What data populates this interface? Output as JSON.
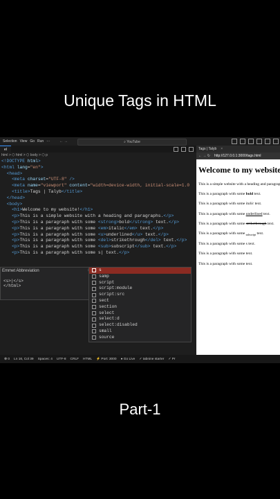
{
  "heading": "Unique Tags in HTML",
  "footer": "Part-1",
  "titlebar": {
    "menu": [
      "Selection",
      "View",
      "Go",
      "Run",
      "···"
    ],
    "nav": "←  →",
    "search": "⌕ YouTube"
  },
  "editor": {
    "tab": "el",
    "breadcrumb": "html > ⬡ html > ⬡ body > ⬡ p",
    "code_lines": [
      [
        [
          "tg",
          "<!DOCTYPE "
        ],
        [
          "at",
          "html"
        ],
        [
          "tg",
          ">"
        ]
      ],
      [
        [
          "tg",
          "<html "
        ],
        [
          "at",
          "lang"
        ],
        [
          "tx",
          "="
        ],
        [
          "st",
          "\"en\""
        ],
        [
          "tg",
          ">"
        ]
      ],
      [
        [
          "tx",
          "  "
        ],
        [
          "tg",
          "<head>"
        ]
      ],
      [
        [
          "tx",
          "    "
        ],
        [
          "tg",
          "<meta "
        ],
        [
          "at",
          "charset"
        ],
        [
          "tx",
          "="
        ],
        [
          "st",
          "\"UTF-8\""
        ],
        [
          "tx",
          " "
        ],
        [
          "tg",
          "/>"
        ]
      ],
      [
        [
          "tx",
          "    "
        ],
        [
          "tg",
          "<meta "
        ],
        [
          "at",
          "name"
        ],
        [
          "tx",
          "="
        ],
        [
          "st",
          "\"viewport\""
        ],
        [
          "tx",
          " "
        ],
        [
          "at",
          "content"
        ],
        [
          "tx",
          "="
        ],
        [
          "st",
          "\"width=device-width, initial-scale=1.0"
        ]
      ],
      [
        [
          "tx",
          "    "
        ],
        [
          "tg",
          "<title>"
        ],
        [
          "tx",
          "Tags | Talyb"
        ],
        [
          "tg",
          "</title>"
        ]
      ],
      [
        [
          "tx",
          "  "
        ],
        [
          "tg",
          "</head>"
        ]
      ],
      [
        [
          "tx",
          "  "
        ],
        [
          "tg",
          "<body>"
        ]
      ],
      [
        [
          "tx",
          "    "
        ],
        [
          "tg",
          "<h1>"
        ],
        [
          "tx",
          "Welcome to my website!"
        ],
        [
          "tg",
          "</h1>"
        ]
      ],
      [
        [
          "tx",
          "    "
        ],
        [
          "tg",
          "<p>"
        ],
        [
          "tx",
          "This is a simple website with a heading and paragraphs."
        ],
        [
          "tg",
          "</p>"
        ]
      ],
      [
        [
          "tx",
          "    "
        ],
        [
          "tg",
          "<p>"
        ],
        [
          "tx",
          "This is a paragraph with some "
        ],
        [
          "tg",
          "<strong>"
        ],
        [
          "tx",
          "bold"
        ],
        [
          "tg",
          "</strong>"
        ],
        [
          "tx",
          " text."
        ],
        [
          "tg",
          "</p>"
        ]
      ],
      [
        [
          "tx",
          "    "
        ],
        [
          "tg",
          "<p>"
        ],
        [
          "tx",
          "This is a paragraph with some "
        ],
        [
          "tg",
          "<em>"
        ],
        [
          "tx",
          "italic"
        ],
        [
          "tg",
          "</em>"
        ],
        [
          "tx",
          " text."
        ],
        [
          "tg",
          "</p>"
        ]
      ],
      [
        [
          "tx",
          "    "
        ],
        [
          "tg",
          "<p>"
        ],
        [
          "tx",
          "This is a paragraph with some "
        ],
        [
          "tg",
          "<u>"
        ],
        [
          "tx",
          "underlined"
        ],
        [
          "tg",
          "</u>"
        ],
        [
          "tx",
          " text."
        ],
        [
          "tg",
          "</p>"
        ]
      ],
      [
        [
          "tx",
          "    "
        ],
        [
          "tg",
          "<p>"
        ],
        [
          "tx",
          "This is a paragraph with some "
        ],
        [
          "tg",
          "<del>"
        ],
        [
          "tx",
          "strikethrough"
        ],
        [
          "tg",
          "</del>"
        ],
        [
          "tx",
          " text."
        ],
        [
          "tg",
          "</p>"
        ]
      ],
      [
        [
          "tx",
          "    "
        ],
        [
          "tg",
          "<p>"
        ],
        [
          "tx",
          "This is a paragraph with some "
        ],
        [
          "tg",
          "<sub>"
        ],
        [
          "tx",
          "subscript"
        ],
        [
          "tg",
          "</sub>"
        ],
        [
          "tx",
          " text."
        ],
        [
          "tg",
          "</p>"
        ]
      ],
      [
        [
          "tx",
          "    "
        ],
        [
          "tg",
          "<p>"
        ],
        [
          "tx",
          "This is a paragraph with some s| text."
        ],
        [
          "tg",
          "</p>"
        ]
      ]
    ],
    "emmet": {
      "title": "Emmet Abbreviation",
      "close": "×",
      "lines": [
        "<s>|</s>",
        "</html>"
      ]
    },
    "suggestions": [
      "s",
      "samp",
      "script",
      "script:module",
      "script:src",
      "sect",
      "section",
      "select",
      "select:d",
      "select:disabled",
      "small",
      "source"
    ]
  },
  "browser": {
    "tab": "Tags | Talyb",
    "tab_close": "×",
    "nav": "←  →  ↻",
    "url": "http://127.0.0.1:3000/tags.html",
    "page": {
      "h1": "Welcome to my website!",
      "p1": "This is a simple website with a heading and paragraphs.",
      "p_prefix": "This is a paragraph with some ",
      "p_suffix": " text.",
      "bold": "bold",
      "italic": "italic",
      "underlined": "underlined",
      "strike": "strikethrough",
      "subscript": "subscript",
      "p7": "This is a paragraph with some s text.",
      "p8": "This is a paragraph with some text.",
      "p9": "This is a paragraph with some text."
    }
  },
  "statusbar": [
    "⊗ 0",
    "Ln 16, Col 39",
    "Spaces: 4",
    "UTF-8",
    "CRLF",
    "HTML",
    "⚡ Port: 3000",
    "● Go Live",
    "✓ tabnine starter",
    "✓ Pr"
  ],
  "colors": {
    "selection": "#8b2b22",
    "editor_bg": "#1e1e1e",
    "tag": "#569cd6",
    "attr": "#9cdcfe",
    "string": "#ce9178"
  }
}
